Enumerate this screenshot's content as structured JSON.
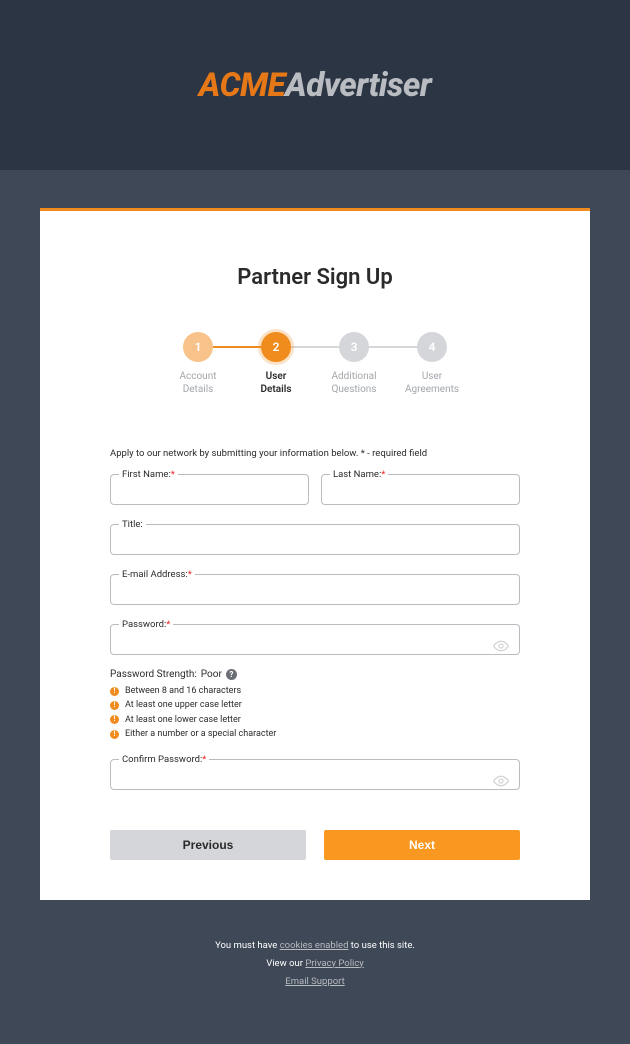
{
  "logo": {
    "part1": "ACME",
    "part2": "Advertiser"
  },
  "page_title": "Partner Sign Up",
  "stepper": {
    "steps": [
      {
        "num": "1",
        "label": "Account\nDetails",
        "state": "done"
      },
      {
        "num": "2",
        "label": "User\nDetails",
        "state": "active"
      },
      {
        "num": "3",
        "label": "Additional\nQuestions",
        "state": "pending"
      },
      {
        "num": "4",
        "label": "User\nAgreements",
        "state": "pending"
      }
    ]
  },
  "instruction": "Apply to our network by submitting your information below. * - required field",
  "fields": {
    "first_name": {
      "label": "First Name:",
      "required": true,
      "value": ""
    },
    "last_name": {
      "label": "Last Name:",
      "required": true,
      "value": ""
    },
    "title": {
      "label": "Title:",
      "required": false,
      "value": ""
    },
    "email": {
      "label": "E-mail Address:",
      "required": true,
      "value": ""
    },
    "password": {
      "label": "Password:",
      "required": true,
      "value": ""
    },
    "confirm_password": {
      "label": "Confirm Password:",
      "required": true,
      "value": ""
    }
  },
  "password_strength": {
    "label": "Password Strength:",
    "value": "Poor"
  },
  "password_rules": [
    "Between 8 and 16 characters",
    "At least one upper case letter",
    "At least one lower case letter",
    "Either a number or a special character"
  ],
  "buttons": {
    "previous": "Previous",
    "next": "Next"
  },
  "footer": {
    "cookies_pre": "You must have ",
    "cookies_link": "cookies enabled",
    "cookies_post": " to use this site.",
    "privacy_pre": "View our ",
    "privacy_link": "Privacy Policy",
    "email_support": "Email Support"
  },
  "colors": {
    "accent": "#f08b1d",
    "accent_light": "#f7c38a",
    "bg_dark": "#3e4857",
    "bg_header": "#2b3543"
  }
}
